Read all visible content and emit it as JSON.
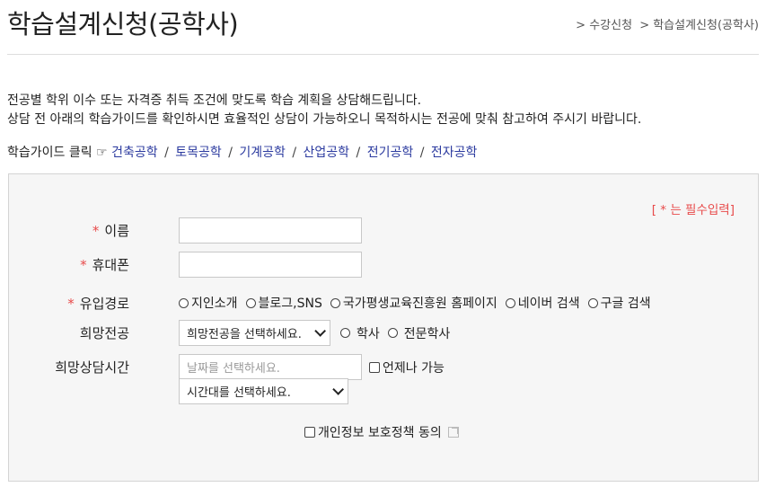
{
  "header": {
    "title": "학습설계신청(공학사)",
    "breadcrumb": [
      "> 수강신청",
      "> 학습설계신청(공학사)"
    ]
  },
  "intro": {
    "line1": "전공별 학위 이수 또는 자격증 취득 조건에 맞도록 학습 계획을 상담해드립니다.",
    "line2": "상담 전 아래의 학습가이드를 확인하시면 효율적인 상담이 가능하오니 목적하시는 전공에 맞춰 참고하여 주시기 바랍니다."
  },
  "guide": {
    "prefix": "학습가이드 클릭 ☞",
    "links": [
      "건축공학",
      "토목공학",
      "기계공학",
      "산업공학",
      "전기공학",
      "전자공학"
    ],
    "separator": "/"
  },
  "form": {
    "required_note": "[ * 는 필수입력]",
    "star": "*",
    "name_label": "이름",
    "name_value": "",
    "phone_label": "휴대폰",
    "phone_value": "",
    "source_label": "유입경로",
    "source_options": [
      "지인소개",
      "블로그,SNS",
      "국가평생교육진흥원 홈페이지",
      "네이버 검색",
      "구글 검색"
    ],
    "major_label": "희망전공",
    "major_select": "희망전공을 선택하세요.",
    "degree_options": [
      "학사",
      "전문학사"
    ],
    "time_label": "희망상담시간",
    "date_placeholder": "날짜를 선택하세요.",
    "anytime_label": "언제나 가능",
    "time_select": "시간대를 선택하세요.",
    "privacy_label": "개인정보 보호정책 동의"
  },
  "colors": {
    "required": "#e84a4a",
    "link": "#2b3a9f",
    "form_bg": "#f6f6f6"
  }
}
